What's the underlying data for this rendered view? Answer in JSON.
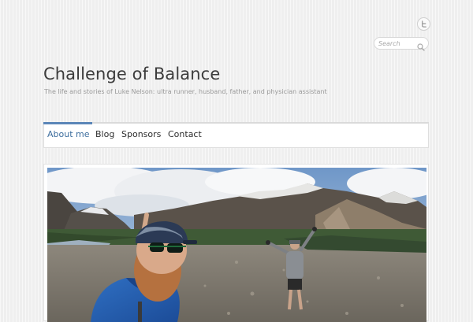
{
  "header": {
    "site_title": "Challenge of Balance",
    "tagline": "The life and stories of Luke Nelson: ultra runner, husband, father, and physician assistant",
    "social": {
      "twitter_icon": "twitter-icon"
    }
  },
  "search": {
    "placeholder": "Search",
    "icon": "search-icon"
  },
  "nav": {
    "items": [
      {
        "label": "About me",
        "active": true
      },
      {
        "label": "Blog",
        "active": false
      },
      {
        "label": "Sponsors",
        "active": false
      },
      {
        "label": "Contact",
        "active": false
      }
    ],
    "active_color": "#5b86b8"
  },
  "main": {
    "featured_image": "mountain-valley-runners-photo"
  }
}
